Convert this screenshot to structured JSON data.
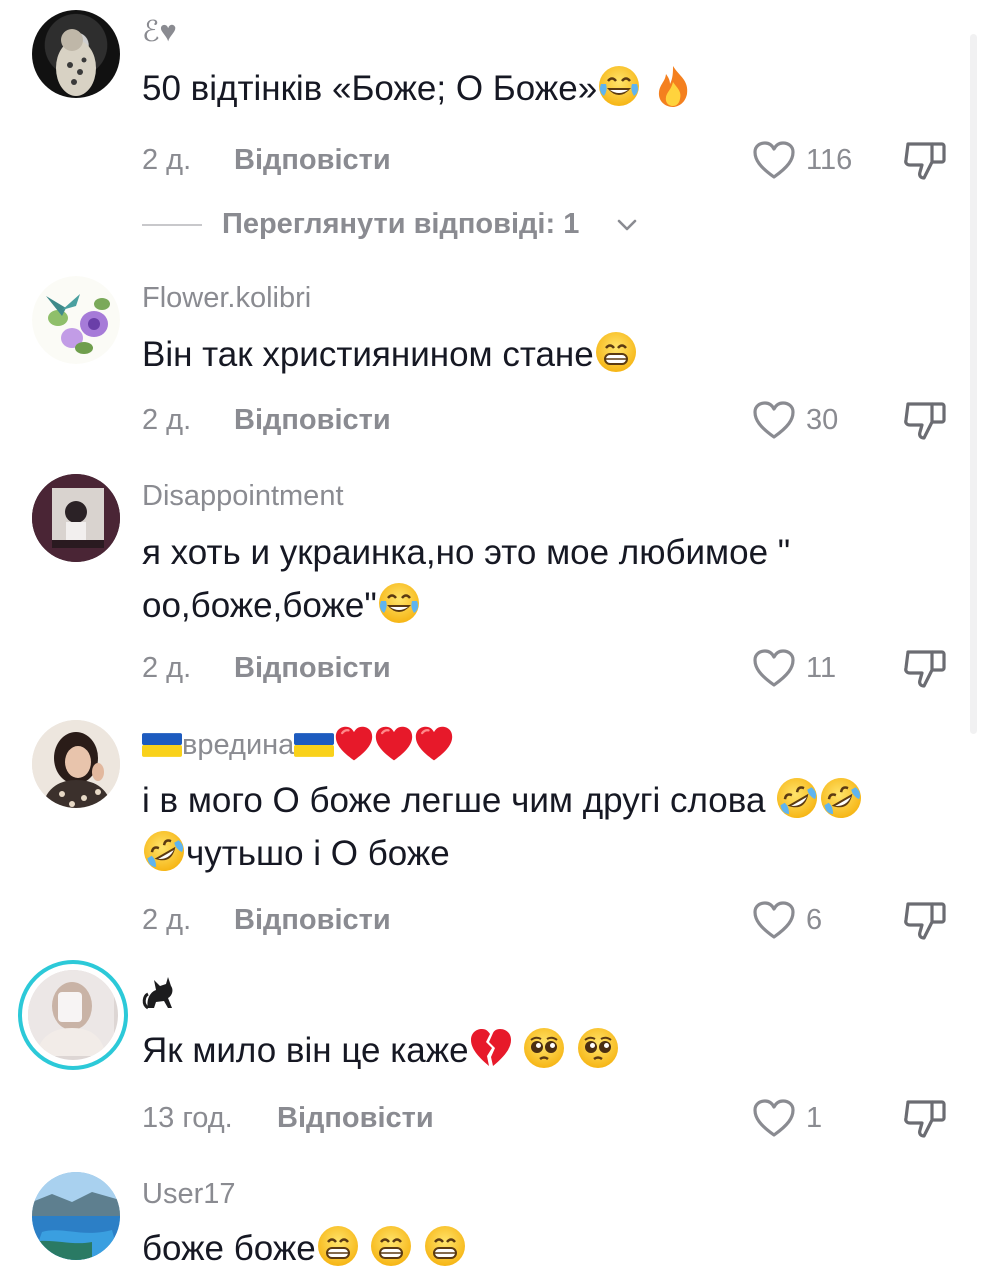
{
  "comments": [
    {
      "username": "ℰ♥",
      "text": "50 відтінків «Боже; О Боже»",
      "time": "2 д.",
      "reply_label": "Відповісти",
      "likes": "116",
      "view_replies": "Переглянути відповіді: 1"
    },
    {
      "username": "Flower.kolibri",
      "text": "Він так християнином стане",
      "time": "2 д.",
      "reply_label": "Відповісти",
      "likes": "30"
    },
    {
      "username": "Disappointment",
      "text_line1": "я хоть и украинка,но это мое любимое \"",
      "text_line2": "оо,боже,боже\"",
      "time": "2 д.",
      "reply_label": "Відповісти",
      "likes": "11"
    },
    {
      "username": "вредина",
      "text_line1": "і в мого О боже легше чим другі слова",
      "text_line2": "чутьшо і О боже",
      "time": "2 д.",
      "reply_label": "Відповісти",
      "likes": "6"
    },
    {
      "username": "🐈‍⬛",
      "text": "Як мило він це каже",
      "time": "13 год.",
      "reply_label": "Відповісти",
      "likes": "1"
    },
    {
      "username": "User17",
      "text": "боже боже",
      "time": "",
      "reply_label": "",
      "likes": ""
    }
  ],
  "colors": {
    "text": "#161823",
    "muted": "#8a8b91",
    "ring": "#2cc9d8"
  }
}
